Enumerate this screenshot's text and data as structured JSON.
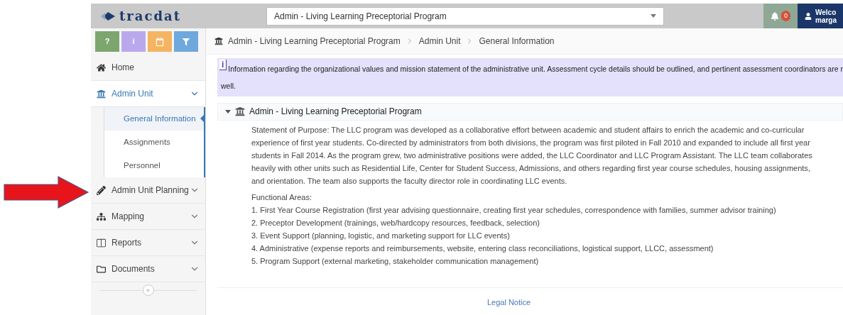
{
  "header": {
    "logo": "tracdat",
    "program_select": {
      "value": "Admin - Living Learning Preceptorial Program"
    },
    "notifications": {
      "count": "0"
    },
    "user": {
      "lines": [
        "Welco",
        "marga"
      ]
    }
  },
  "quick_buttons": [
    {
      "kind": "text",
      "label": "?",
      "color": "#7da66f"
    },
    {
      "kind": "text",
      "label": "i",
      "color": "#b9a9ec"
    },
    {
      "kind": "calendar",
      "color": "#f5b461"
    },
    {
      "kind": "filter",
      "color": "#6fa8dc"
    }
  ],
  "sidebar": {
    "items": [
      {
        "kind": "link",
        "label": "Home",
        "expanded": false
      },
      {
        "kind": "group",
        "label": "Admin Unit",
        "expanded": true,
        "children": [
          {
            "label": "General Information",
            "selected": true
          },
          {
            "label": "Assignments",
            "selected": false
          },
          {
            "label": "Personnel",
            "selected": false
          }
        ]
      },
      {
        "kind": "group",
        "label": "Admin Unit Planning",
        "expanded": false
      },
      {
        "kind": "group",
        "label": "Mapping",
        "expanded": false
      },
      {
        "kind": "group",
        "label": "Reports",
        "expanded": false
      },
      {
        "kind": "group",
        "label": "Documents",
        "expanded": false
      }
    ],
    "collapse": "«"
  },
  "breadcrumb": [
    "Admin - Living Learning Preceptorial Program",
    "Admin Unit",
    "General Information"
  ],
  "info_banner": {
    "icon": "i",
    "lines": [
      "Information regarding the organizational values and mission statement of the administrative unit. Assessment cycle details should be outlined, and pertinent assessment coordinators are r",
      "well."
    ]
  },
  "section": {
    "title": "Admin - Living Learning Preceptorial Program",
    "expanded": true,
    "statement": "Statement of Purpose: The LLC program was developed as a collaborative effort between academic and student affairs to enrich the academic and co-curricular experience of first year students. Co-directed by administrators from both divisions, the program was first piloted in Fall 2010 and expanded to include all first year students in Fall 2014. As the program grew, two administrative positions were added, the LLC Coordinator and LLC Program Assistant. The LLC team collaborates heavily with other units such as Residential Life, Center for Student Success, Admissions, and others regarding first year course schedules, housing assignments, and orientation. The team also supports the faculty director role in coordinating LLC events.",
    "areas_heading": "Functional Areas:",
    "areas": [
      "1. First Year Course Registration (first year advising questionnaire, creating first year schedules, correspondence with families, summer advisor training)",
      "2. Preceptor Development (trainings, web/hardcopy resources, feedback, selection)",
      "3. Event Support (planning, logistic, and marketing support for LLC events)",
      "4. Administrative (expense reports and reimbursements, website, entering class reconciliations, logistical support, LLCC, assessment)",
      "5. Program Support (external marketing, stakeholder communication management)"
    ]
  },
  "footer": {
    "link": "Legal Notice"
  }
}
